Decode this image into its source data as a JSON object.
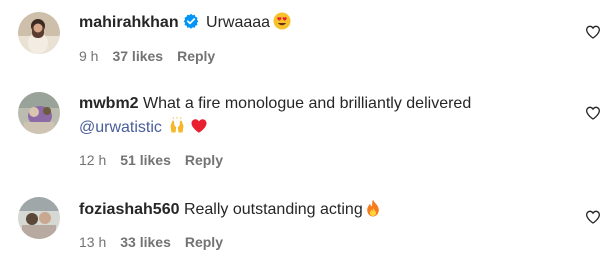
{
  "comments": [
    {
      "username": "mahirahkhan",
      "verified": true,
      "text": "Urwaaaa",
      "time": "9 h",
      "likes": "37 likes",
      "reply": "Reply",
      "emoji": "heart-eyes-emoji"
    },
    {
      "username": "mwbm2",
      "verified": false,
      "text": "What a fire monologue and brilliantly delivered",
      "mention": "@urwatistic",
      "time": "12 h",
      "likes": "51 likes",
      "reply": "Reply",
      "emoji": [
        "raising-hands-emoji",
        "red-heart-emoji"
      ]
    },
    {
      "username": "foziashah560",
      "verified": false,
      "text": "Really outstanding acting",
      "time": "13 h",
      "likes": "33 likes",
      "reply": "Reply",
      "emoji": "fire-emoji"
    }
  ],
  "colors": {
    "username": "#262626",
    "meta": "#737373",
    "mention": "#4a5d9c",
    "verified": "#0095f6",
    "heart_red": "#e8202f"
  }
}
